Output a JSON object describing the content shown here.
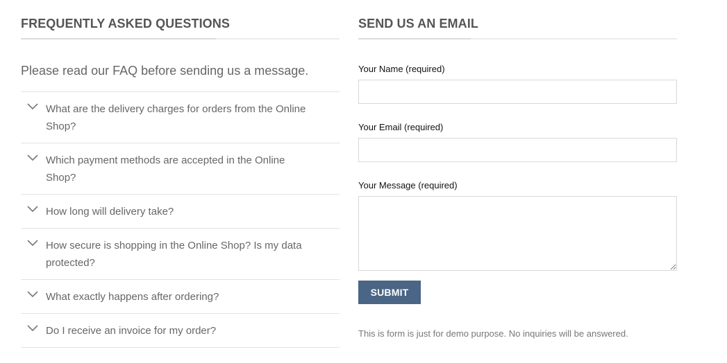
{
  "faq": {
    "heading": "FREQUENTLY ASKED QUESTIONS",
    "intro": "Please read our FAQ before sending us a message.",
    "items": [
      {
        "question": "What are the delivery charges for orders from the Online Shop?"
      },
      {
        "question": "Which payment methods are accepted in the Online Shop?"
      },
      {
        "question": "How long will delivery take?"
      },
      {
        "question": "How secure is shopping in the Online Shop? Is my data protected?"
      },
      {
        "question": "What exactly happens after ordering?"
      },
      {
        "question": "Do I receive an invoice for my order?"
      }
    ],
    "expand_icon": "chevron-down-icon"
  },
  "contact": {
    "heading": "SEND US AN EMAIL",
    "name_label": "Your Name (required)",
    "name_value": "",
    "email_label": "Your Email (required)",
    "email_value": "",
    "message_label": "Your Message (required)",
    "message_value": "",
    "submit_label": "SUBMIT",
    "note": "This is form is just for demo purpose. No inquiries will be answered."
  },
  "colors": {
    "accent": "#4a6585",
    "heading_text": "#555555",
    "divider": "#e2e2e2"
  }
}
